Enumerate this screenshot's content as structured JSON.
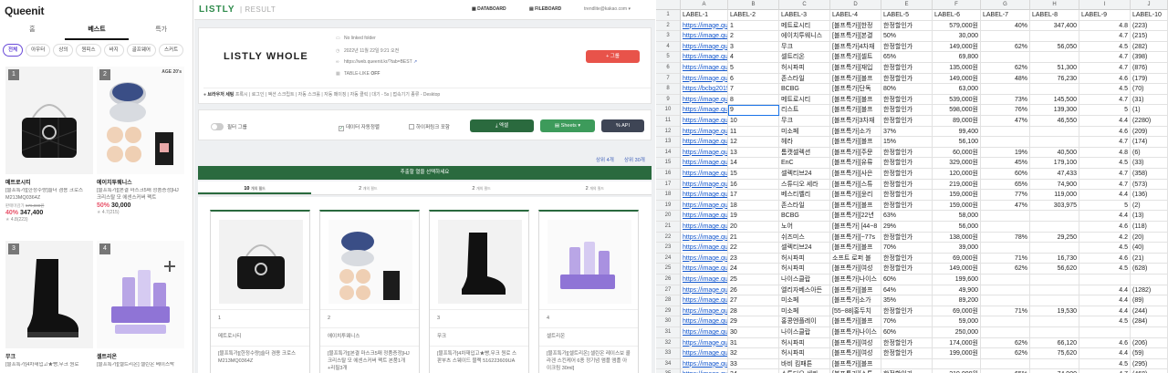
{
  "queenit": {
    "logo": "Queenit",
    "tabs": [
      "홈",
      "베스트",
      "특가"
    ],
    "chips": [
      "전체",
      "아우터",
      "상의",
      "원피스",
      "바지",
      "골프웨어",
      "스커트"
    ],
    "products": [
      {
        "num": "1",
        "brand": "메트로시티",
        "title": "[블프특가][한정수량]슬더 겸용 크로스 M213MQ0364Z",
        "label_small": "판매마감가",
        "orig": "579,000원",
        "discount": "40%",
        "price": "347,400",
        "rating": "4.8",
        "reviews": "(223)"
      },
      {
        "num": "2",
        "brand": "에이치투웨니스",
        "title": "[블프특가][본결 마스크5매 정품증정]HJ 크리스탈 모 에센스커버 팩트",
        "discount": "50%",
        "price": "30,000",
        "rating": "4.7",
        "reviews": "(215)",
        "badge": "AGE 20's"
      },
      {
        "num": "3",
        "brand": "무크",
        "title": "[블프특가]4차재입고★빵,무크 원로"
      },
      {
        "num": "4",
        "brand": "셀트리온",
        "title": "[블프특가][셀트리온] 셀린온 베이스박"
      }
    ]
  },
  "listly": {
    "logo": "LISTLY",
    "logo_sub": "RESULT",
    "nav": [
      "DATABOARD",
      "FILEBOARD"
    ],
    "user": "trendlite@kakao.com",
    "title": "LISTLY WHOLE",
    "meta": {
      "folder": "No linked folder",
      "date": "2022년 11월 22일 9:21 오전",
      "url": "https://web.queenit.kr/?tab=BEST",
      "table": "TABLE-LIKE",
      "table_state": "OFF"
    },
    "group_button": "+ 그룹",
    "config": {
      "browser_label": "브라우저 세팅",
      "items": "프록시 | 로그인 | 액션 스크립트 | 자동 스크롤 | 자동 페이징 | 자동 클릭 | 대기 - 5s | 접속기기 종류 - Desktop"
    },
    "filter_label": "필터 그룹",
    "checks": [
      "데이터 자동정렬",
      "하이퍼링크 포함"
    ],
    "buttons": {
      "excel": "엑셀",
      "sheets": "Sheets",
      "api": "API"
    },
    "counts": [
      "상위 4개",
      "상위 30개"
    ],
    "select_label": "추출할 열을 선택하세요",
    "output_tabs": [
      {
        "n": "10",
        "label": "개의 필드"
      },
      {
        "n": "2",
        "label": "개의 필드"
      },
      {
        "n": "2",
        "label": "개의 필드"
      },
      {
        "n": "2",
        "label": "개의 필드"
      }
    ],
    "items": [
      {
        "idx": "1",
        "brand": "메트로시티",
        "title": "[블프특가][한정수량]슬더 겸용 크로스 M213MQ0364Z"
      },
      {
        "idx": "2",
        "brand": "에이치투웨니스",
        "title": "[블프특가][본결 마스크5매 정품증정]HJ 크리스탈 모 에센스커버 팩트 본품1개+리필3개"
      },
      {
        "idx": "3",
        "brand": "무크",
        "title": "[블프특가]4차재입고★빵,무크 원로 스판부츠 스웨이드 블랙 516223609UA"
      },
      {
        "idx": "4",
        "brand": "셀트리온",
        "title": "[블프특가][셀트리온] 셀린온 레이스보 콜라겐 스킨케어 6종 정기념 앰플 앰플 아이크림 30ml]"
      }
    ]
  },
  "sheet": {
    "cols": [
      "A",
      "B",
      "C",
      "D",
      "E",
      "F",
      "G",
      "H",
      "I",
      "J"
    ],
    "rows": [
      [
        "LABEL-1",
        "LABEL-2",
        "LABEL-3",
        "LABEL-4",
        "LABEL-5",
        "LABEL-6",
        "LABEL-7",
        "LABEL-8",
        "LABEL-9",
        "LABEL-10"
      ],
      [
        "https://image.qu",
        "1",
        "메트로시티",
        "[블프특가][한정",
        "한정할인가",
        "579,000원",
        "40%",
        "347,400",
        "4.8",
        "(223)"
      ],
      [
        "https://image.qu",
        "2",
        "에이치투웨니스",
        "[블프특가][본결",
        "50%",
        "30,000",
        "",
        "",
        "4.7",
        "(215)"
      ],
      [
        "https://image.qu",
        "3",
        "무크",
        "[블프특가]4차재",
        "한정할인가",
        "149,000원",
        "62%",
        "56,050",
        "4.5",
        "(282)"
      ],
      [
        "https://image.qu",
        "4",
        "셀트리온",
        "[블프특가][셀트",
        "65%",
        "69,800",
        "",
        "",
        "4.7",
        "(398)"
      ],
      [
        "https://image.qu",
        "5",
        "허시파피",
        "[블프특가][재입",
        "한정할인가",
        "135,000원",
        "62%",
        "51,300",
        "4.7",
        "(876)"
      ],
      [
        "https://image.qu",
        "6",
        "존스타일",
        "[블프특가][블프",
        "한정할인가",
        "149,000원",
        "48%",
        "76,230",
        "4.6",
        "(179)"
      ],
      [
        "https://bcbg2015",
        "7",
        "BCBG",
        "[블프특가]단독",
        "80%",
        "63,000",
        "",
        "",
        "4.5",
        "(70)"
      ],
      [
        "https://image.qu",
        "8",
        "메트로시티",
        "[블프특가][블프",
        "한정할인가",
        "539,000원",
        "73%",
        "145,500",
        "4.7",
        "(31)"
      ],
      [
        "https://image.qu",
        "9",
        "리스트",
        "[블프특가][블프",
        "한정할인가",
        "598,000원",
        "76%",
        "139,300",
        "5",
        "(1)"
      ],
      [
        "https://image.qu",
        "10",
        "무크",
        "[블프특가]3차재",
        "한정할인가",
        "89,000원",
        "47%",
        "46,550",
        "4.4",
        "(2280)"
      ],
      [
        "https://image.qu",
        "11",
        "미소페",
        "[블프특가]소가",
        "37%",
        "99,400",
        "",
        "",
        "4.6",
        "(209)"
      ],
      [
        "https://image.qu",
        "12",
        "헤라",
        "[블프특가][블프",
        "15%",
        "56,100",
        "",
        "",
        "4.7",
        "(174)"
      ],
      [
        "https://image.qu",
        "13",
        "톰캣셀렉션",
        "[블프특가][주문",
        "한정할인가",
        "60,000원",
        "19%",
        "40,500",
        "4.8",
        "(6)"
      ],
      [
        "https://image.qu",
        "14",
        "EnC",
        "[블프특가][유류",
        "한정할인가",
        "329,000원",
        "45%",
        "179,100",
        "4.5",
        "(33)"
      ],
      [
        "https://image.qu",
        "15",
        "셀렉티브24",
        "[블프특가][사은",
        "한정할인가",
        "120,000원",
        "60%",
        "47,433",
        "4.7",
        "(358)"
      ],
      [
        "https://image.qu",
        "16",
        "스튜디오 세라",
        "[블프특가][스튜",
        "한정할인가",
        "219,000원",
        "65%",
        "74,900",
        "4.7",
        "(573)"
      ],
      [
        "https://image.qu",
        "17",
        "베스티벨리",
        "[블프특가][윤리",
        "한정할인가",
        "159,000원",
        "77%",
        "119,000",
        "4.4",
        "(136)"
      ],
      [
        "https://image.qu",
        "18",
        "존스타일",
        "[블프특가][블프",
        "한정할인가",
        "159,000원",
        "47%",
        "303,975",
        "5",
        "(2)"
      ],
      [
        "https://image.qu",
        "19",
        "BCBG",
        "[블프특가][22년",
        "63%",
        "58,000",
        "",
        "",
        "4.4",
        "(13)"
      ],
      [
        "https://image.qu",
        "20",
        "노어",
        "[블프특가] [44~8",
        "29%",
        "56,000",
        "",
        "",
        "4.6",
        "(118)"
      ],
      [
        "https://image.qu",
        "21",
        "쉬즈미스",
        "[블프특가][~77s",
        "한정할인가",
        "138,000원",
        "78%",
        "29,250",
        "4.2",
        "(20)"
      ],
      [
        "https://image.qu",
        "22",
        "셀렉티브24",
        "[블프특가][블프",
        "70%",
        "39,000",
        "",
        "",
        "4.5",
        "(40)"
      ],
      [
        "https://image.qu",
        "23",
        "허시파피",
        "소프트 로퍼 블",
        "한정할인가",
        "69,000원",
        "71%",
        "16,730",
        "4.6",
        "(21)"
      ],
      [
        "https://image.qu",
        "24",
        "허시파피",
        "[블프특가][여성",
        "한정할인가",
        "149,000원",
        "62%",
        "56,620",
        "4.5",
        "(628)"
      ],
      [
        "https://image.qu",
        "25",
        "나이스클랍",
        "[블프특가]나이스",
        "60%",
        "199,600",
        "",
        "",
        "",
        ""
      ],
      [
        "https://image.qu",
        "26",
        "엘리자베스아든",
        "[블프특가][블프",
        "64%",
        "49,900",
        "",
        "",
        "4.4",
        "(1282)"
      ],
      [
        "https://image.qu",
        "27",
        "미소페",
        "[블프특가]소가",
        "35%",
        "89,200",
        "",
        "",
        "4.4",
        "(89)"
      ],
      [
        "https://image.qu",
        "28",
        "미소페",
        "[55~88]홍두치",
        "한정할인가",
        "69,000원",
        "71%",
        "19,530",
        "4.4",
        "(244)"
      ],
      [
        "https://image.qu",
        "29",
        "홍콩엔플레이",
        "[블프특가][블프",
        "70%",
        "59,000",
        "",
        "",
        "4.5",
        "(284)"
      ],
      [
        "https://image.qu",
        "30",
        "나이스클랍",
        "[블프특가]나이스",
        "60%",
        "250,000",
        "",
        "",
        "",
        ""
      ],
      [
        "https://image.qu",
        "31",
        "허시파피",
        "[블프특가][여성",
        "한정할인가",
        "174,000원",
        "62%",
        "66,120",
        "4.6",
        "(206)"
      ],
      [
        "https://image.qu",
        "32",
        "허시파피",
        "[블프특가][여성",
        "한정할인가",
        "199,000원",
        "62%",
        "75,620",
        "4.4",
        "(59)"
      ],
      [
        "https://image.qu",
        "33",
        "바비 킴패튼",
        "[블프특가][블프",
        "",
        "",
        "",
        "",
        "4.5",
        "(295)"
      ],
      [
        "https://image.qu",
        "34",
        "스튜디오 세라",
        "[블프특가][스튜",
        "한정할인가",
        "219,000원",
        "65%",
        "74,900",
        "4.7",
        "(468)"
      ]
    ]
  }
}
